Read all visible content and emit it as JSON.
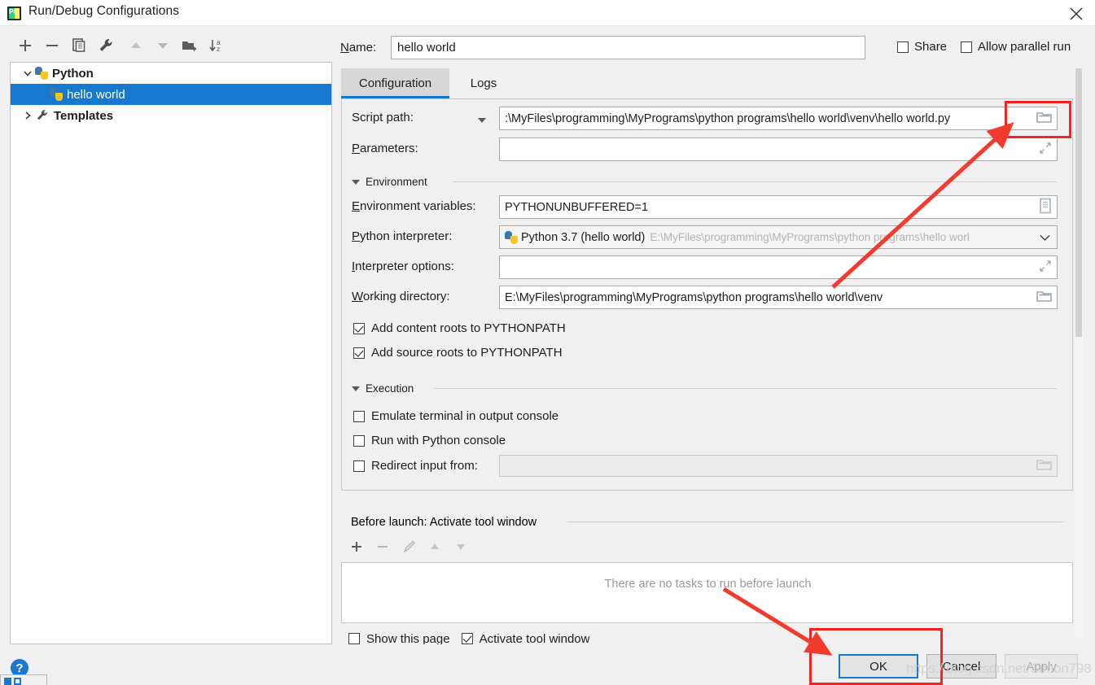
{
  "window": {
    "title": "Run/Debug Configurations",
    "app_icon": "pycharm-icon",
    "close_icon": "close-icon"
  },
  "left_toolbar": {
    "buttons": [
      {
        "name": "add-configuration-button",
        "icon": "plus-icon",
        "glyph": "+",
        "enabled": true
      },
      {
        "name": "remove-configuration-button",
        "icon": "minus-icon",
        "glyph": "−",
        "enabled": true
      },
      {
        "name": "copy-configuration-button",
        "icon": "copy-icon",
        "glyph": "",
        "enabled": true
      },
      {
        "name": "edit-templates-button",
        "icon": "wrench-icon",
        "glyph": "",
        "enabled": true
      },
      {
        "name": "move-up-button",
        "icon": "arrow-up-icon",
        "glyph": "",
        "enabled": false
      },
      {
        "name": "move-down-button",
        "icon": "arrow-down-icon",
        "glyph": "",
        "enabled": false
      },
      {
        "name": "new-folder-button",
        "icon": "folder-add-icon",
        "glyph": "",
        "enabled": true
      },
      {
        "name": "sort-configurations-button",
        "icon": "sort-az-icon",
        "glyph": "",
        "enabled": true
      }
    ]
  },
  "tree": {
    "items": [
      {
        "label": "Python",
        "icon": "python-icon",
        "expanded": true,
        "selected": false,
        "bold": true,
        "level": 0
      },
      {
        "label": "hello world",
        "icon": "python-icon",
        "expanded": null,
        "selected": true,
        "bold": false,
        "level": 1
      },
      {
        "label": "Templates",
        "icon": "wrench-icon",
        "expanded": false,
        "selected": false,
        "bold": true,
        "level": 0
      }
    ]
  },
  "header": {
    "name_label": "Name:",
    "name_value": "hello world",
    "name_placeholder": "",
    "share_label": "Share",
    "share_checked": false,
    "parallel_label": "Allow parallel run",
    "parallel_checked": false
  },
  "tabs": [
    {
      "label": "Configuration",
      "active": true
    },
    {
      "label": "Logs",
      "active": false
    }
  ],
  "config": {
    "script_path_label": "Script path:",
    "script_path_value": ":\\MyFiles\\programming\\MyPrograms\\python programs\\hello world\\venv\\hello world.py",
    "parameters_label": "Parameters:",
    "parameters_value": "",
    "environment_section": "Environment",
    "env_vars_label": "Environment variables:",
    "env_vars_value": "PYTHONUNBUFFERED=1",
    "interpreter_label": "Python interpreter:",
    "interpreter_value": "Python 3.7 (hello world)",
    "interpreter_path": "E:\\MyFiles\\programming\\MyPrograms\\python programs\\hello worl",
    "interpreter_options_label": "Interpreter options:",
    "interpreter_options_value": "",
    "working_dir_label": "Working directory:",
    "working_dir_value": "E:\\MyFiles\\programming\\MyPrograms\\python programs\\hello world\\venv",
    "add_content_roots_label": "Add content roots to PYTHONPATH",
    "add_content_roots_checked": true,
    "add_source_roots_label": "Add source roots to PYTHONPATH",
    "add_source_roots_checked": true,
    "execution_section": "Execution",
    "emulate_terminal_label": "Emulate terminal in output console",
    "emulate_terminal_checked": false,
    "run_python_console_label": "Run with Python console",
    "run_python_console_checked": false,
    "redirect_input_label": "Redirect input from:",
    "redirect_input_checked": false,
    "redirect_input_value": ""
  },
  "before_launch": {
    "header": "Before launch: Activate tool window",
    "toolbar": [
      {
        "name": "add-task-button",
        "icon": "plus-icon",
        "enabled": true
      },
      {
        "name": "remove-task-button",
        "icon": "minus-icon",
        "enabled": false
      },
      {
        "name": "edit-task-button",
        "icon": "pencil-icon",
        "enabled": false
      },
      {
        "name": "task-move-up-button",
        "icon": "arrow-up-icon",
        "enabled": false
      },
      {
        "name": "task-move-down-button",
        "icon": "arrow-down-icon",
        "enabled": false
      }
    ],
    "empty_text": "There are no tasks to run before launch",
    "show_page_label": "Show this page",
    "show_page_checked": false,
    "activate_tool_window_label": "Activate tool window",
    "activate_tool_window_checked": true
  },
  "footer": {
    "ok_label": "OK",
    "cancel_label": "Cancel",
    "apply_label": "Apply",
    "apply_enabled": false,
    "help_label": "?"
  },
  "annotations": {
    "highlight_color": "#fa2121",
    "arrow_color": "#f23a2e",
    "watermark": "https://blog.csdn.net/Simon798"
  },
  "colors": {
    "accent": "#1778cf",
    "selection": "#1778cf",
    "panel": "#f0f0f0",
    "field_bg": "#ffffff",
    "text": "#1d1d1d",
    "dim_text": "#b4b4b4"
  }
}
